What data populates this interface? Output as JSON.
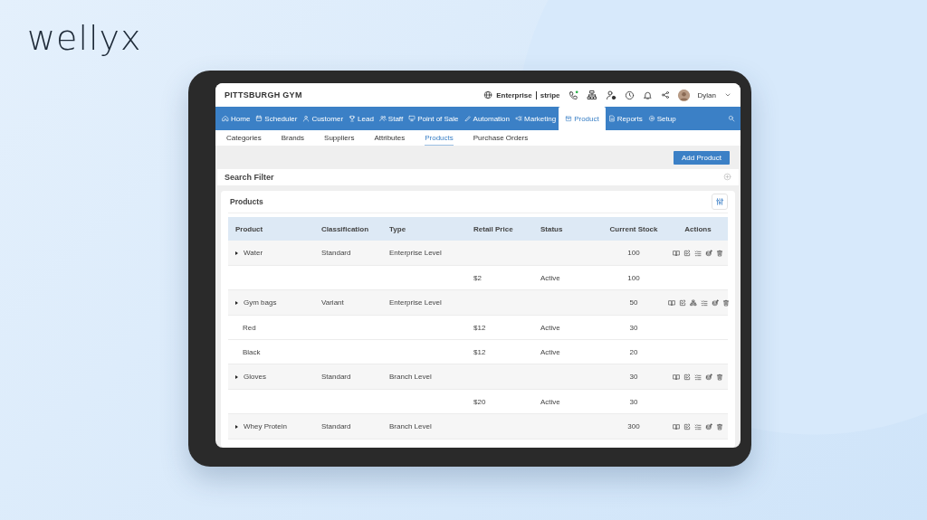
{
  "brand": {
    "logo": "wellyx"
  },
  "header": {
    "title": "PITTSBURGH GYM",
    "plan": "Enterprise",
    "payment": "stripe",
    "user": "Dylan"
  },
  "nav": [
    {
      "label": "Home",
      "kind": "home",
      "selected": false
    },
    {
      "label": "Scheduler",
      "kind": "calendar",
      "selected": false
    },
    {
      "label": "Customer",
      "kind": "user",
      "selected": false
    },
    {
      "label": "Lead",
      "kind": "trophy",
      "selected": false
    },
    {
      "label": "Staff",
      "kind": "staff",
      "selected": false
    },
    {
      "label": "Point of Sale",
      "kind": "pos",
      "selected": false
    },
    {
      "label": "Automation",
      "kind": "pen",
      "selected": false
    },
    {
      "label": "Marketing",
      "kind": "megaphone",
      "selected": false
    },
    {
      "label": "Product",
      "kind": "box",
      "selected": true
    },
    {
      "label": "Reports",
      "kind": "report",
      "selected": false
    },
    {
      "label": "Setup",
      "kind": "gear",
      "selected": false
    }
  ],
  "subnav": [
    {
      "label": "Categories",
      "selected": false
    },
    {
      "label": "Brands",
      "selected": false
    },
    {
      "label": "Suppliers",
      "selected": false
    },
    {
      "label": "Attributes",
      "selected": false
    },
    {
      "label": "Products",
      "selected": true
    },
    {
      "label": "Purchase Orders",
      "selected": false
    }
  ],
  "add_button": "Add Product",
  "search_filter": {
    "title": "Search Filter"
  },
  "products": {
    "title": "Products",
    "columns": [
      "Product",
      "Classification",
      "Type",
      "Retail Price",
      "Status",
      "Current Stock",
      "Actions"
    ],
    "rows": [
      {
        "kind": "product",
        "product": "Water",
        "classification": "Standard",
        "type": "Enterprise Level",
        "stock": "100",
        "actions": [
          {
            "kind": "view"
          },
          {
            "kind": "edit"
          },
          {
            "kind": "checklist"
          },
          {
            "kind": "stock"
          },
          {
            "kind": "delete"
          }
        ]
      },
      {
        "kind": "variant",
        "price": "$2",
        "status": "Active",
        "stock": "100"
      },
      {
        "kind": "product",
        "product": "Gym bags",
        "classification": "Variant",
        "type": "Enterprise Level",
        "stock": "50",
        "actions": [
          {
            "kind": "view"
          },
          {
            "kind": "edit"
          },
          {
            "kind": "variants"
          },
          {
            "kind": "checklist"
          },
          {
            "kind": "stock"
          },
          {
            "kind": "delete"
          }
        ]
      },
      {
        "kind": "variant",
        "product": "Red",
        "price": "$12",
        "status": "Active",
        "stock": "30"
      },
      {
        "kind": "variant",
        "product": "Black",
        "price": "$12",
        "status": "Active",
        "stock": "20"
      },
      {
        "kind": "product",
        "product": "Gloves",
        "classification": "Standard",
        "type": "Branch Level",
        "stock": "30",
        "actions": [
          {
            "kind": "view"
          },
          {
            "kind": "edit"
          },
          {
            "kind": "checklist"
          },
          {
            "kind": "stock"
          },
          {
            "kind": "delete"
          }
        ]
      },
      {
        "kind": "variant",
        "price": "$20",
        "status": "Active",
        "stock": "30"
      },
      {
        "kind": "product",
        "product": "Whey Protein",
        "classification": "Standard",
        "type": "Branch Level",
        "stock": "300",
        "actions": [
          {
            "kind": "view"
          },
          {
            "kind": "edit"
          },
          {
            "kind": "checklist"
          },
          {
            "kind": "stock"
          },
          {
            "kind": "delete"
          }
        ]
      }
    ]
  }
}
